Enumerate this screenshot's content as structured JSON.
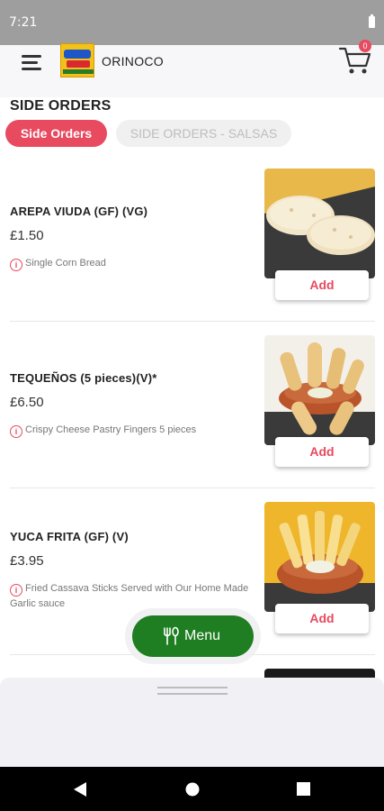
{
  "status_bar": {
    "time": "7:21"
  },
  "header": {
    "brand": "ORINOCO",
    "cart_count": "0"
  },
  "section": {
    "title": "SIDE ORDERS"
  },
  "tabs": [
    {
      "label": "Side Orders",
      "active": true
    },
    {
      "label": "SIDE ORDERS - SALSAS",
      "active": false
    }
  ],
  "items": [
    {
      "name": "AREPA VIUDA (GF) (VG)",
      "price": "£1.50",
      "description": "Single Corn Bread",
      "add_label": "Add"
    },
    {
      "name": "TEQUEÑOS (5 pieces)(V)*",
      "price": "£6.50",
      "description": "Crispy Cheese Pastry Fingers 5 pieces",
      "add_label": "Add"
    },
    {
      "name": "YUCA FRITA (GF) (V)",
      "price": "£3.95",
      "description": "Fried Cassava Sticks Served with Our Home Made Garlic sauce",
      "add_label": "Add"
    }
  ],
  "menu_button": {
    "label": "Menu"
  },
  "colors": {
    "accent": "#e84a5f",
    "menu_green": "#1e7e21",
    "status_bar": "#9e9e9e"
  }
}
